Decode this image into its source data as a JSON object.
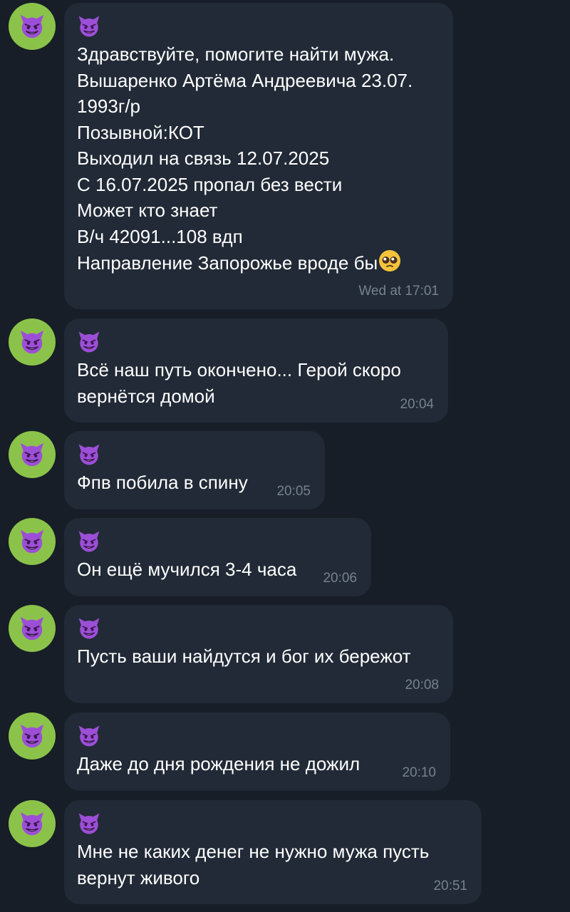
{
  "colors": {
    "background": "#171e27",
    "bubble": "#212a36",
    "avatar": "#8bc34a",
    "text": "#ffffff",
    "time": "#77818d",
    "devil_emoji": "#9c4fd6"
  },
  "sender_icon": "smiling-devil-emoji",
  "messages": [
    {
      "text": "Здравствуйте, помогите найти мужа.\nВышаренко Артёма Андреевича 23.07.\n1993г/р\nПозывной:КОТ\nВыходил на связь 12.07.2025\nС 16.07.2025 пропал без вести\nМожет кто знает\nВ/ч 42091...108 вдп\nНаправление Запорожье вроде бы",
      "trailing_emoji": "pleading-face-emoji",
      "time": "Wed at 17:01"
    },
    {
      "text": "Всё наш путь окончено... Герой скоро\nвернётся домой",
      "time": "20:04"
    },
    {
      "text": "Фпв побила в спину",
      "time": "20:05"
    },
    {
      "text": "Он ещё мучился 3-4 часа",
      "time": "20:06"
    },
    {
      "text": "Пусть ваши найдутся и бог их бережот",
      "time": "20:08"
    },
    {
      "text": "Даже до дня рождения не дожил",
      "time": "20:10"
    },
    {
      "text": "Мне не каких денег не нужно мужа пусть\nвернут живого",
      "time": "20:51"
    }
  ]
}
